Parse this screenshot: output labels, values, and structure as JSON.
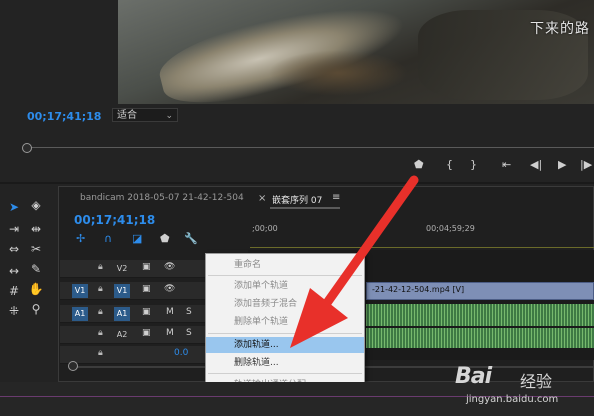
{
  "program_monitor": {
    "subtitle_text": "下来的路",
    "timecode": "00;17;41;18",
    "fit_select": "适合",
    "transport_buttons": [
      "marker-icon",
      "in-point-icon",
      "out-point-icon",
      "go-to-in-icon",
      "step-back-icon",
      "play-icon",
      "step-forward-icon"
    ]
  },
  "timeline": {
    "tabs": {
      "source_tab": "bandicam 2018-05-07 21-42-12-504",
      "close_glyph": "×",
      "sequence_tab": "嵌套序列 07",
      "menu_glyph": "≡"
    },
    "timecode": "00;17;41;18",
    "ruler": {
      "start": ";00;00",
      "mark": "00;04;59;29"
    },
    "tracks": [
      {
        "source_patch": "",
        "target": "V2",
        "type": "video"
      },
      {
        "source_patch": "V1",
        "target": "V1",
        "type": "video"
      },
      {
        "source_patch": "A1",
        "target": "A1",
        "type": "audio",
        "m": "M",
        "s": "S"
      },
      {
        "source_patch": "",
        "target": "A2",
        "type": "audio",
        "m": "M",
        "s": "S"
      },
      {
        "source_patch": "",
        "target": "",
        "type": "master",
        "value": "0.0"
      }
    ],
    "clips": {
      "v1_label": "-21-42-12-504.mp4 [V]"
    }
  },
  "context_menu": {
    "items": [
      {
        "label": "重命名",
        "enabled": false,
        "highlighted": false
      },
      {
        "label": "添加单个轨道",
        "enabled": false,
        "highlighted": false
      },
      {
        "label": "添加音频子混合",
        "enabled": false,
        "highlighted": false
      },
      {
        "label": "删除单个轨道",
        "enabled": false,
        "highlighted": false
      },
      {
        "label": "添加轨道...",
        "enabled": true,
        "highlighted": true
      },
      {
        "label": "删除轨道...",
        "enabled": true,
        "highlighted": false
      },
      {
        "label": "轨道输出通道分配...",
        "enabled": false,
        "highlighted": false
      }
    ]
  },
  "watermark": {
    "logo": "Bai",
    "logo_suffix": "经验",
    "url": "jingyan.baidu.com"
  },
  "colors": {
    "timecode_blue": "#2d8ceb",
    "menu_highlight": "#99c6ee",
    "arrow_red": "#e8302a",
    "video_clip": "#7e8fb6",
    "audio_clip": "#3e7a44"
  }
}
